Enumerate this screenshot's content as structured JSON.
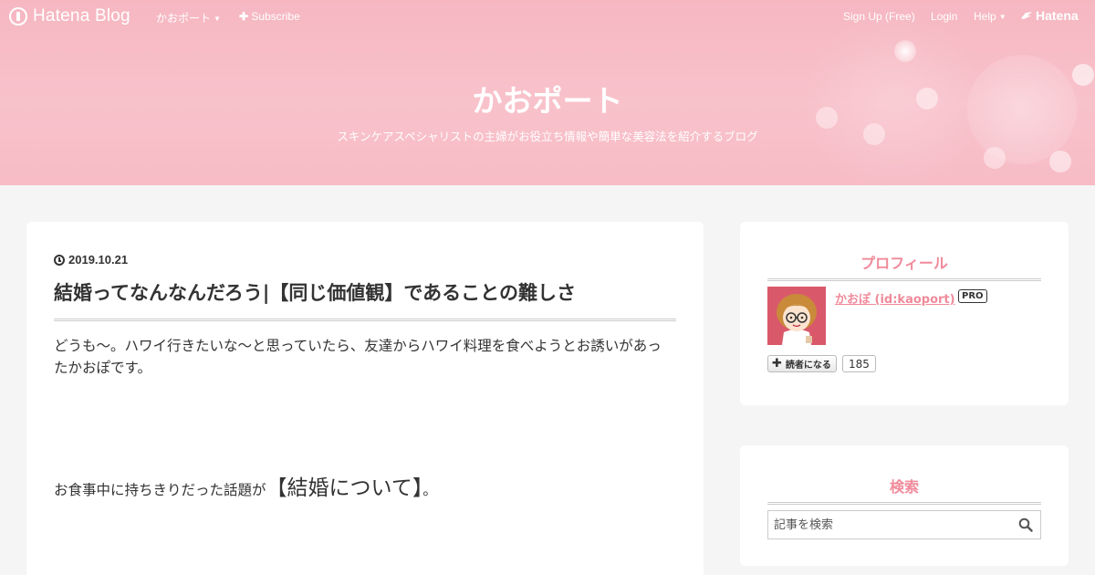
{
  "topbar": {
    "logo_text": "Hatena Blog",
    "blog_menu": "かおポート",
    "subscribe": "Subscribe",
    "signup": "Sign Up (Free)",
    "login": "Login",
    "help": "Help",
    "hatena": "Hatena"
  },
  "header": {
    "title": "かおポート",
    "description": "スキンケアスペシャリストの主婦がお役立ち情報や簡単な美容法を紹介するブログ"
  },
  "article": {
    "date": "2019.10.21",
    "title": "結婚ってなんなんだろう|【同じ価値観】であることの難しさ",
    "para1": "どうも〜。ハワイ行きたいな〜と思っていたら、友達からハワイ料理を食べようとお誘いがあったかおぽです。",
    "para2_prefix": "お食事中に持ちきりだった話題が",
    "para2_big": "【結婚について】",
    "para2_suffix": "。"
  },
  "sidebar": {
    "profile": {
      "heading": "プロフィール",
      "name": "かおぽ (id:kaoport)",
      "badge": "PRO",
      "reader_button": "読者になる",
      "reader_count": "185"
    },
    "search": {
      "heading": "検索",
      "placeholder": "記事を検索"
    }
  },
  "colors": {
    "accent": "#f08a9a",
    "hero_pink": "#f7bcc6",
    "avatar_bg": "#d9596a"
  }
}
